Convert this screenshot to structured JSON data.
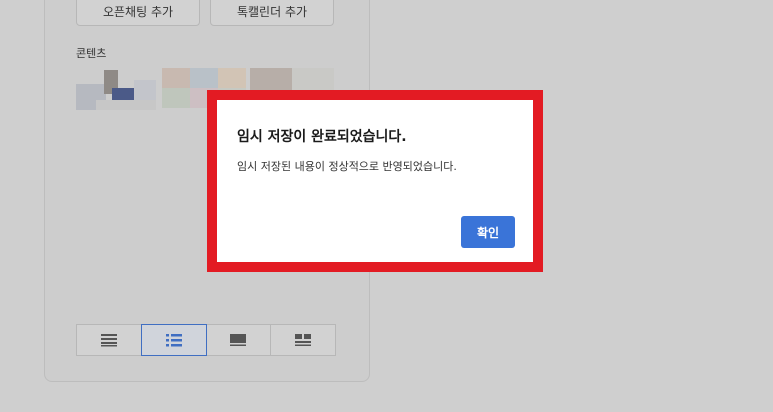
{
  "panel": {
    "top_buttons": [
      {
        "label": "오픈채팅 추가"
      },
      {
        "label": "톡캘린더 추가"
      }
    ],
    "contents_label": "콘텐츠",
    "view_options": [
      {
        "icon": "text-lines-icon",
        "selected": false
      },
      {
        "icon": "bulleted-list-icon",
        "selected": true
      },
      {
        "icon": "large-card-icon",
        "selected": false
      },
      {
        "icon": "grid-card-icon",
        "selected": false
      }
    ]
  },
  "dialog": {
    "title": "임시 저장이 완료되었습니다.",
    "message": "임시 저장된 내용이 정상적으로 반영되었습니다.",
    "confirm_label": "확인"
  },
  "colors": {
    "highlight_border": "#e31b23",
    "primary_button": "#3a74d8",
    "overlay_background": "#cfcfcf"
  }
}
